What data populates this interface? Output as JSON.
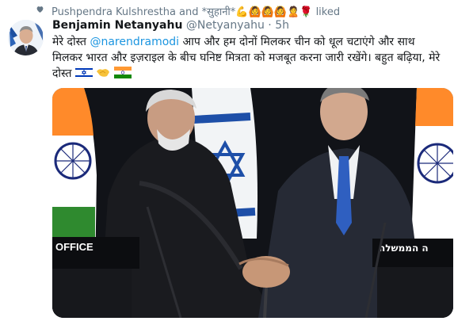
{
  "liked": {
    "names": "Pushpendra Kulshrestha and *सुहानी*",
    "emojis": "💪🙆🙆🙆🙎🌹",
    "label": "liked"
  },
  "tweet": {
    "author_name": "Benjamin Netanyahu",
    "handle": "@Netyanyahu",
    "separator": "·",
    "time": "5h",
    "text_part1": "मेरे दोस्त ",
    "mention": "@narendramodi",
    "text_part2": " आप और हम दोनों मिलकर चीन को धूल चटाएंगे और साथ मिलकर भारत और इज़राइल के बीच घनिष्ट मित्रता को मजबूत करना जारी रखेंगे। बहुत बढ़िया, मेरे दोस्त "
  },
  "photo": {
    "podium_left_text": "OFFICE",
    "podium_right_text": "ה הממשלה"
  },
  "colors": {
    "link": "#1b95e0",
    "secondary": "#657786",
    "saffron": "#ff9933",
    "india_green": "#138808",
    "ashoka_blue": "#000080",
    "israel_blue": "#0038b8"
  }
}
